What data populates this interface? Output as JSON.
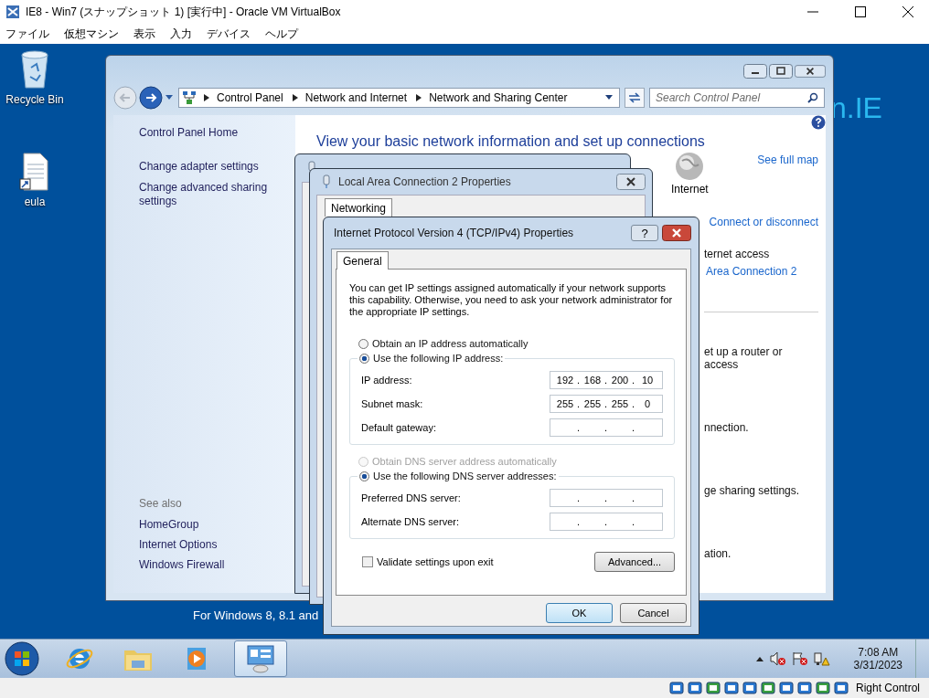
{
  "host": {
    "title": "IE8 - Win7 (スナップショット 1) [実行中] - Oracle VM VirtualBox",
    "menu": [
      "ファイル",
      "仮想マシン",
      "表示",
      "入力",
      "デバイス",
      "ヘルプ"
    ],
    "status_text": "Right Control"
  },
  "desktop": {
    "icons": [
      {
        "label": "Recycle Bin",
        "kind": "recycle"
      },
      {
        "label": "eula",
        "kind": "file"
      }
    ],
    "wallpaper_text": "n.IE",
    "banner": "For Windows 8, 8.1 and"
  },
  "control_panel": {
    "breadcrumb": [
      "Control Panel",
      "Network and Internet",
      "Network and Sharing Center"
    ],
    "search": {
      "placeholder": "Search Control Panel"
    },
    "sidebar": {
      "links": [
        "Control Panel Home",
        "Change adapter settings",
        "Change advanced sharing settings"
      ],
      "see_also_title": "See also",
      "see_also": [
        "HomeGroup",
        "Internet Options",
        "Windows Firewall"
      ]
    },
    "heading": "View your basic network information and set up connections",
    "internet_label": "Internet",
    "see_full_map": "See full map",
    "connect": "Connect or disconnect",
    "access_type": "ternet access",
    "connection_link": "Area Connection 2",
    "tasks": [
      "et up a router or access",
      "nnection.",
      "ge sharing settings.",
      "ation."
    ]
  },
  "properties_dialog": {
    "title": "Local Area Connection 2 Properties",
    "tab": "Networking"
  },
  "ipv4_dialog": {
    "title": "Internet Protocol Version 4 (TCP/IPv4) Properties",
    "help": "?",
    "tab": "General",
    "intro": "You can get IP settings assigned automatically if your network supports this capability. Otherwise, you need to ask your network administrator for the appropriate IP settings.",
    "ip_mode": [
      {
        "label": "Obtain an IP address automatically",
        "selected": false,
        "disabled": false
      },
      {
        "label": "Use the following IP address:",
        "selected": true,
        "disabled": false
      }
    ],
    "ip_fields": [
      {
        "label": "IP address:",
        "octets": [
          "192",
          "168",
          "200",
          "10"
        ]
      },
      {
        "label": "Subnet mask:",
        "octets": [
          "255",
          "255",
          "255",
          "0"
        ]
      },
      {
        "label": "Default gateway:"
      }
    ],
    "dns_mode": [
      {
        "label": "Obtain DNS server address automatically",
        "selected": false,
        "disabled": true
      },
      {
        "label": "Use the following DNS server addresses:",
        "selected": true,
        "disabled": false
      }
    ],
    "dns_fields": [
      {
        "label": "Preferred DNS server:"
      },
      {
        "label": "Alternate DNS server:"
      }
    ],
    "separator": ".",
    "validate": {
      "label": "Validate settings upon exit",
      "checked": false
    },
    "advanced": "Advanced...",
    "ok": "OK",
    "cancel": "Cancel"
  },
  "taskbar": {
    "apps": [
      {
        "kind": "ie",
        "selected": false
      },
      {
        "kind": "explorer",
        "selected": false
      },
      {
        "kind": "media",
        "selected": false
      },
      {
        "kind": "control",
        "selected": true
      }
    ],
    "time": "7:08 AM",
    "date": "3/31/2023"
  }
}
